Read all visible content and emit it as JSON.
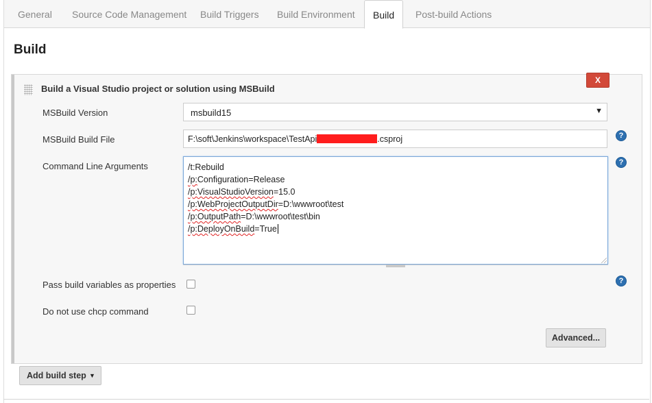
{
  "tabs": [
    {
      "label": "General",
      "active": false
    },
    {
      "label": "Source Code Management",
      "active": false
    },
    {
      "label": "Build Triggers",
      "active": false
    },
    {
      "label": "Build Environment",
      "active": false
    },
    {
      "label": "Build",
      "active": true
    },
    {
      "label": "Post-build Actions",
      "active": false
    }
  ],
  "section": {
    "title": "Build"
  },
  "step": {
    "title": "Build a Visual Studio project or solution using MSBuild",
    "delete_label": "X",
    "fields": {
      "msbuild_version": {
        "label": "MSBuild Version",
        "value": "msbuild15"
      },
      "build_file": {
        "label": "MSBuild Build File",
        "value_prefix": "F:\\soft\\Jenkins\\workspace\\TestApi",
        "value_suffix": ".csproj"
      },
      "cmd_args": {
        "label": "Command Line Arguments",
        "lines": [
          {
            "prefix": "/t:",
            "word": "Rebuild",
            "rest": ""
          },
          {
            "prefix": "/p:",
            "word": "Configuration",
            "rest": "=Release"
          },
          {
            "prefix": "/p:",
            "word": "VisualStudioVersion",
            "rest": "=15.0"
          },
          {
            "prefix": "/p:",
            "word": "WebProjectOutputDir",
            "rest": "=D:\\wwwroot\\test"
          },
          {
            "prefix": "/p:",
            "word": "OutputPath",
            "rest": "=D:\\wwwroot\\test\\bin"
          },
          {
            "prefix": "/p:",
            "word": "DeployOnBuild",
            "rest": "=True"
          }
        ]
      },
      "pass_vars": {
        "label": "Pass build variables as properties",
        "checked": false
      },
      "no_chcp": {
        "label": "Do not use chcp command",
        "checked": false
      }
    },
    "advanced_label": "Advanced..."
  },
  "add_build_step_label": "Add build step",
  "help_glyph": "?",
  "caret_glyph": "▼",
  "colors": {
    "delete_red": "#d24939",
    "help_blue": "#2e70b0",
    "focus_blue": "#7aa7d8"
  }
}
